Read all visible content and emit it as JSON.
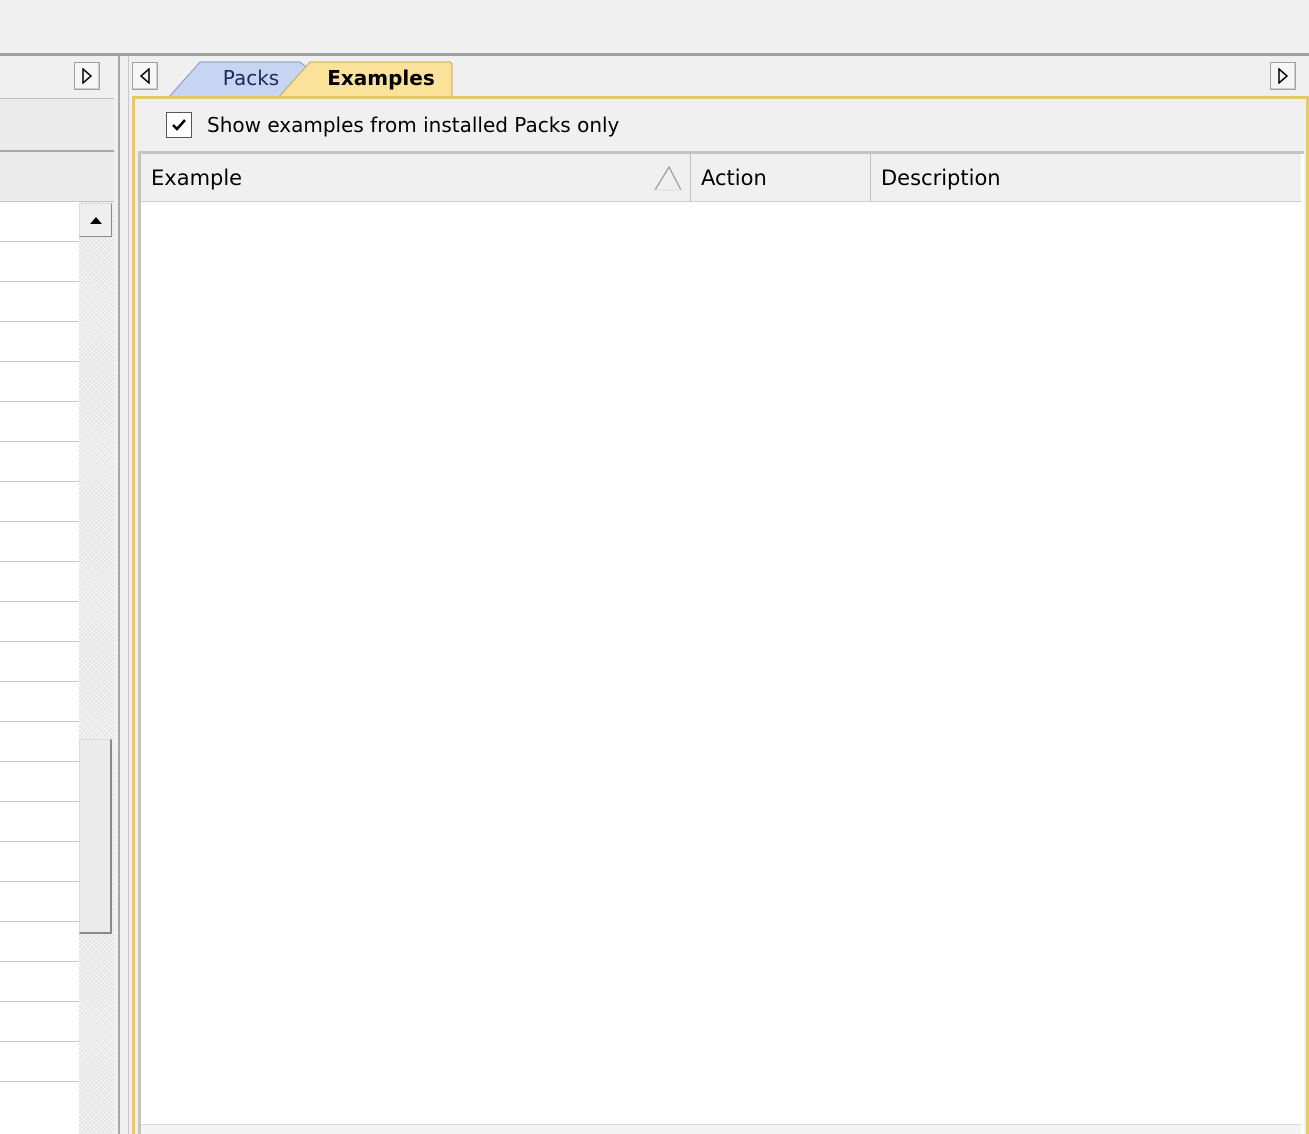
{
  "left_panel": {
    "next_tab_icon": "triangle-right-icon",
    "scroll_up_icon": "triangle-up-icon"
  },
  "right_panel": {
    "prev_tab_icon": "triangle-left-icon",
    "next_tab_icon": "triangle-right-icon",
    "tabs": [
      {
        "label": "Packs",
        "active": false,
        "color": "#c7d5f2"
      },
      {
        "label": "Examples",
        "active": true,
        "color": "#fbe29a"
      }
    ],
    "filter": {
      "checkbox_checked": true,
      "label": "Show examples from installed Packs only"
    },
    "grid": {
      "columns": [
        {
          "label": "Example",
          "sorted": "ascending"
        },
        {
          "label": "Action"
        },
        {
          "label": "Description"
        }
      ],
      "rows": []
    }
  },
  "colors": {
    "active_tab": "#fbe29a",
    "inactive_tab": "#c7d5f2",
    "frame_accent": "#e7c86e"
  }
}
